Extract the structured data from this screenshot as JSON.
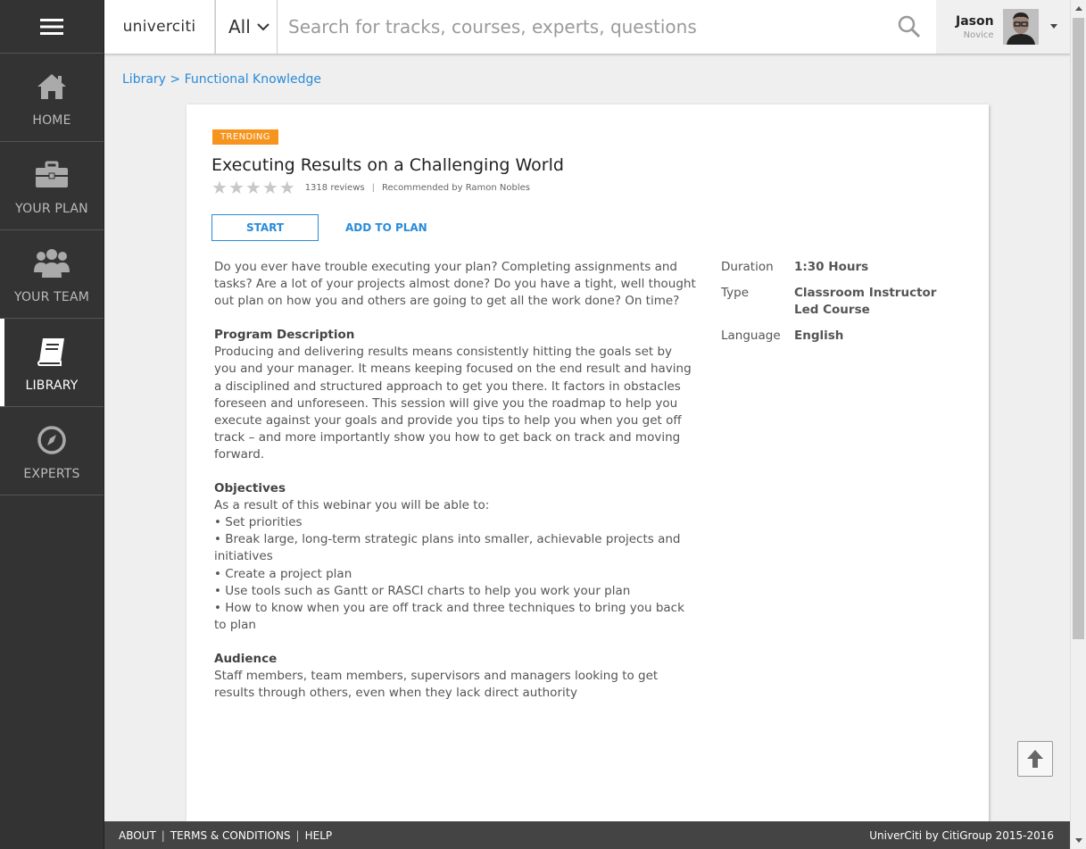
{
  "sidebar": {
    "items": [
      {
        "label": "HOME",
        "icon": "home-icon"
      },
      {
        "label": "YOUR PLAN",
        "icon": "briefcase-icon"
      },
      {
        "label": "YOUR TEAM",
        "icon": "team-icon"
      },
      {
        "label": "LIBRARY",
        "icon": "book-icon",
        "active": true
      },
      {
        "label": "EXPERTS",
        "icon": "compass-icon"
      }
    ]
  },
  "header": {
    "logo": "univerciti",
    "scope_value": "All",
    "search_placeholder": "Search for tracks, courses, experts, questions",
    "user_name": "Jason",
    "user_level": "Novice"
  },
  "breadcrumb": {
    "text": "Library > Functional Knowledge"
  },
  "course": {
    "badge": "TRENDING",
    "title": "Executing Results on a Challenging World",
    "rating_stars": 0,
    "reviews": "1318 reviews",
    "recommended": "Recommended by Ramon Nobles",
    "start_label": "START",
    "add_label": "ADD TO PLAN",
    "intro": "Do you ever have trouble executing your plan? Completing assignments and tasks? Are a lot of your projects almost done? Do you have a tight, well thought out plan on how you and others are going to get all the work done? On time?",
    "program_heading": "Program Description",
    "program_text": "Producing and delivering results means consistently hitting the goals set by you and your manager. It means keeping focused on the end result and having a disciplined and structured approach to get you there. It factors in obstacles foreseen and unforeseen. This session will give you the roadmap to help you execute against your goals and provide you tips to help you when you get off track – and more importantly show you how to get back on track and moving forward.",
    "objectives_heading": "Objectives",
    "objectives_intro": "As a result of this webinar you will be able to:",
    "objectives": [
      "• Set priorities",
      "• Break large, long-term strategic plans into smaller, achievable projects and initiatives",
      "• Create a project plan",
      "• Use tools such as Gantt or RASCI charts to help you work your plan",
      "• How to know when you are off track and three techniques to bring you back to plan"
    ],
    "audience_heading": "Audience",
    "audience_text": "Staff members, team members, supervisors and managers looking to get results through others, even when they lack direct authority",
    "meta": {
      "duration_label": "Duration",
      "duration_value": "1:30 Hours",
      "type_label": "Type",
      "type_value": "Classroom Instructor Led Course",
      "language_label": "Language",
      "language_value": "English"
    }
  },
  "footer": {
    "about": "ABOUT",
    "terms": "TERMS & CONDITIONS",
    "help": "HELP",
    "sep": "|",
    "copyright": "UniverCiti by CitiGroup 2015-2016"
  },
  "colors": {
    "sidebar_bg": "#333333",
    "accent_blue": "#2a8bd8",
    "badge_orange": "#f7941d",
    "footer_bg": "#444444"
  }
}
